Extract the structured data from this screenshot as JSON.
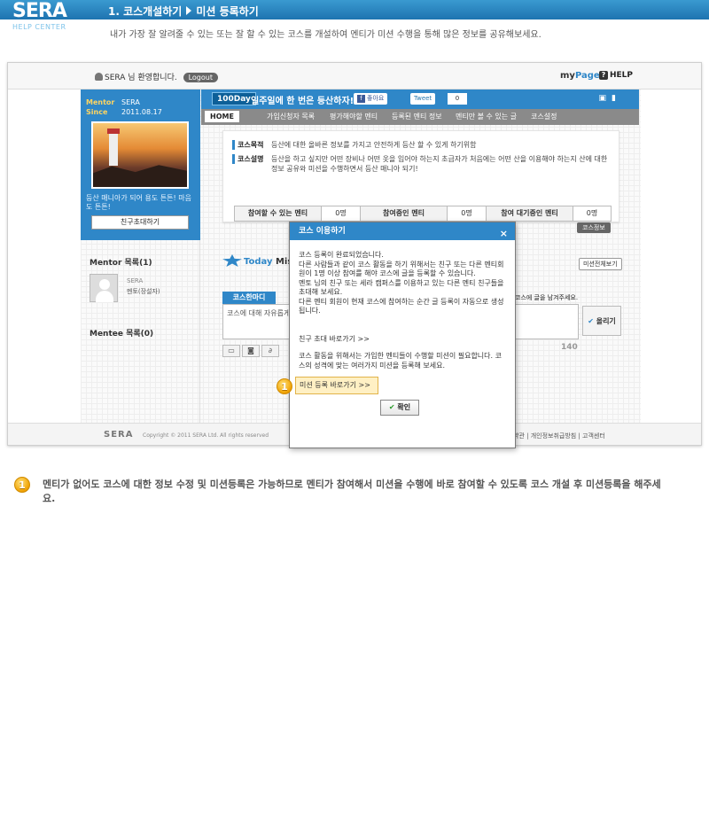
{
  "help": {
    "logo": "SERA",
    "logo_sub": "HELP CENTER",
    "step": "1. 코스개설하기",
    "step_sub": "미션 등록하기",
    "description": "내가 가장 잘 알려줄 수 있는 또는 잘 할 수 있는 코스를 개설하여 멘티가 미션 수행을 통해 많은 정보를 공유해보세요."
  },
  "topnav": {
    "welcome": "SERA 님 환영합니다.",
    "logout": "Logout",
    "mypage_prefix": "my",
    "mypage_suffix": "Page",
    "help_icon": "?",
    "help": "HELP"
  },
  "profile": {
    "mentor_label": "Mentor",
    "mentor_name": "SERA",
    "since_label": "Since",
    "since_date": "2011.08.17",
    "message": "등산 매니아가 되어 용도 튼튼! 마음도 튼튼!",
    "invite_button": "친구초대하기"
  },
  "left": {
    "mentor_list_title": "Mentor 목록(1)",
    "mentor_name": "SERA",
    "mentor_role": "멘토(장설자)",
    "mentee_list_title": "Mentee 목록(0)"
  },
  "course": {
    "day_badge": "100Day",
    "title": "일주일에 한 번은 등산하자!",
    "like_icon": "f",
    "like_label": "좋아요",
    "tweet_label": "Tweet",
    "tweet_count": "0",
    "tabs": [
      "HOME",
      "가입신청자 목록",
      "평가해야할 멘티",
      "등록된 멘티 정보",
      "멘티만 볼 수 있는 글",
      "코스설정"
    ],
    "purpose_label": "코스목적",
    "purpose": "등산에 대한 올바른 정보를 가지고 안전하게 등산 할 수 있게 하기위함",
    "desc_label": "코스설명",
    "desc": "등산을 하고 싶지만 어떤 장비나 어떤 옷을 입어야 하는지 초급자가 처음에는 어떤 산을 이용해야 하는지 산에 대한 정보 공유와 미션을 수행하면서 등산 매니아 되기!",
    "stats": [
      {
        "label": "참여할 수 있는 멘티",
        "value": "0명"
      },
      {
        "label": "참여중인 멘티",
        "value": "0명"
      },
      {
        "label": "참여 대기중인 멘티",
        "value": "0명"
      }
    ],
    "info_tag": "코스정보",
    "today_prefix": "Today",
    "today_suffix": "Miss",
    "all_missions": "미션전체보기",
    "comment_tab": "코스한마디",
    "comment_hint": "코스에 글을 남겨주세요.",
    "comment_placeholder": "코스에 대해 자유롭게",
    "post_check": "✔",
    "post_button": "올리기",
    "char_count": "140"
  },
  "modal": {
    "title": "코스 이용하기",
    "close": "×",
    "body": [
      "코스 등록이 완료되었습니다.",
      "다른 사람들과 같이 코스 활동을 하기 위해서는 친구 또는 다른 멘티회원이 1명 이상 참여를 해야 코스에 글을 등록할 수 있습니다.",
      "멘토 님의 친구 또는 세라 캠퍼스를 이용하고 있는 다른 멘티 친구들을 초대해 보세요.",
      "다른 멘티 회원이 현재 코스에 참여하는 순간 글 등록이 자동으로 생성 됩니다."
    ],
    "invite_link": "친구 초대 바로가기 >>",
    "tip": "코스 활동을 위해서는 가입한 멘티들이 수행할 미션이 필요합니다. 코스의 성격에 맞는 여러가지 미션을 등록해 보세요.",
    "mission_button": "미션 등록 바로가기 >>",
    "confirm_check": "✔",
    "confirm_button": "확인"
  },
  "footer": {
    "logo": "SERA",
    "copyright": "Copyright © 2011 SERA Ltd.   All rights reserved",
    "links": "약관 | 개인정보취급방침 | 고객센터"
  },
  "note": {
    "badge": "1",
    "text": "멘티가 없어도 코스에 대한 정보 수정 및 미션등록은 가능하므로 멘티가 참여해서 미션을 수행에 바로 참여할 수 있도록 코스 개설 후 미션등록을 해주세요."
  }
}
